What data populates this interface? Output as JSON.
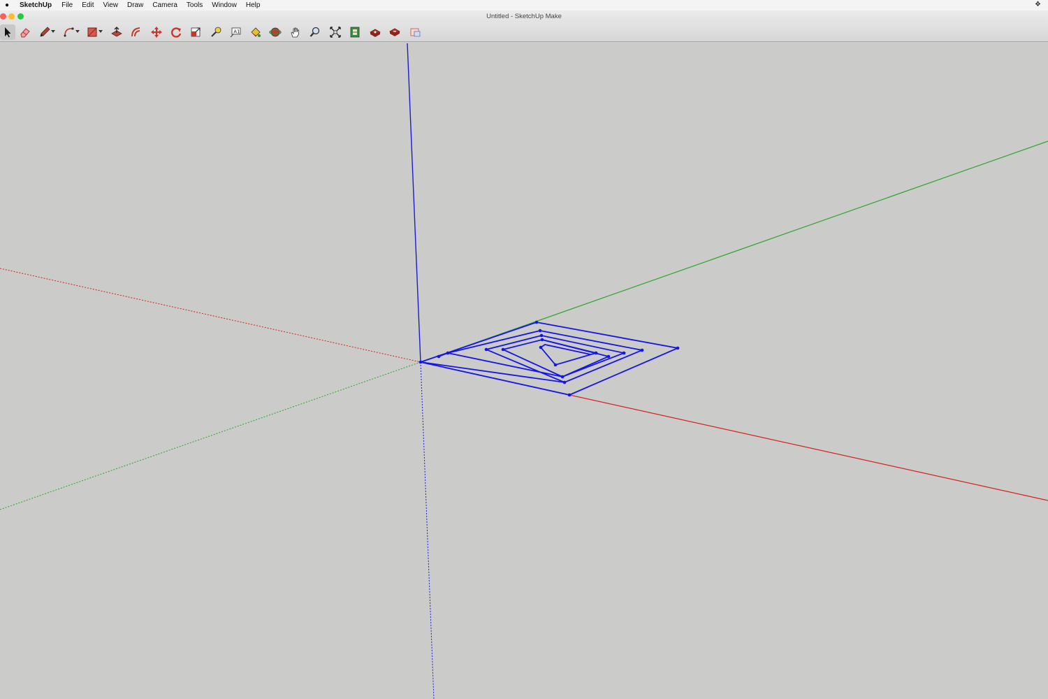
{
  "menubar": {
    "app_name": "SketchUp",
    "items": [
      "File",
      "Edit",
      "View",
      "Draw",
      "Camera",
      "Tools",
      "Window",
      "Help"
    ]
  },
  "window": {
    "title": "Untitled - SketchUp Make"
  },
  "toolbar": {
    "tools": [
      {
        "name": "select-tool",
        "icon": "arrow-cursor-icon"
      },
      {
        "name": "eraser-tool",
        "icon": "eraser-icon"
      },
      {
        "name": "line-tool",
        "icon": "pencil-icon",
        "dropdown": true
      },
      {
        "name": "arc-tool",
        "icon": "arc-icon",
        "dropdown": true
      },
      {
        "name": "rectangle-tool",
        "icon": "rectangle-icon",
        "dropdown": true
      },
      {
        "name": "push-pull-tool",
        "icon": "push-pull-icon"
      },
      {
        "name": "offset-tool",
        "icon": "offset-icon"
      },
      {
        "name": "move-tool",
        "icon": "move-icon"
      },
      {
        "name": "rotate-tool",
        "icon": "rotate-icon"
      },
      {
        "name": "scale-tool",
        "icon": "scale-icon"
      },
      {
        "name": "tape-measure-tool",
        "icon": "tape-measure-icon"
      },
      {
        "name": "text-tool",
        "icon": "text-icon"
      },
      {
        "name": "paint-bucket-tool",
        "icon": "paint-bucket-icon"
      },
      {
        "name": "orbit-tool",
        "icon": "orbit-icon"
      },
      {
        "name": "pan-tool",
        "icon": "hand-icon"
      },
      {
        "name": "zoom-tool",
        "icon": "magnifier-icon"
      },
      {
        "name": "zoom-extents-tool",
        "icon": "zoom-extents-icon"
      },
      {
        "name": "warehouse-tool",
        "icon": "warehouse-icon"
      },
      {
        "name": "extension-warehouse-tool",
        "icon": "extension-warehouse-icon"
      },
      {
        "name": "share-model-tool",
        "icon": "share-model-icon"
      },
      {
        "name": "layout-tool",
        "icon": "layout-icon"
      }
    ]
  },
  "colors": {
    "canvas": "#cbcbc9",
    "x_axis": "#d2231e",
    "y_axis": "#2fa52b",
    "z_axis": "#1b1bd6",
    "selection": "#1515e8"
  }
}
